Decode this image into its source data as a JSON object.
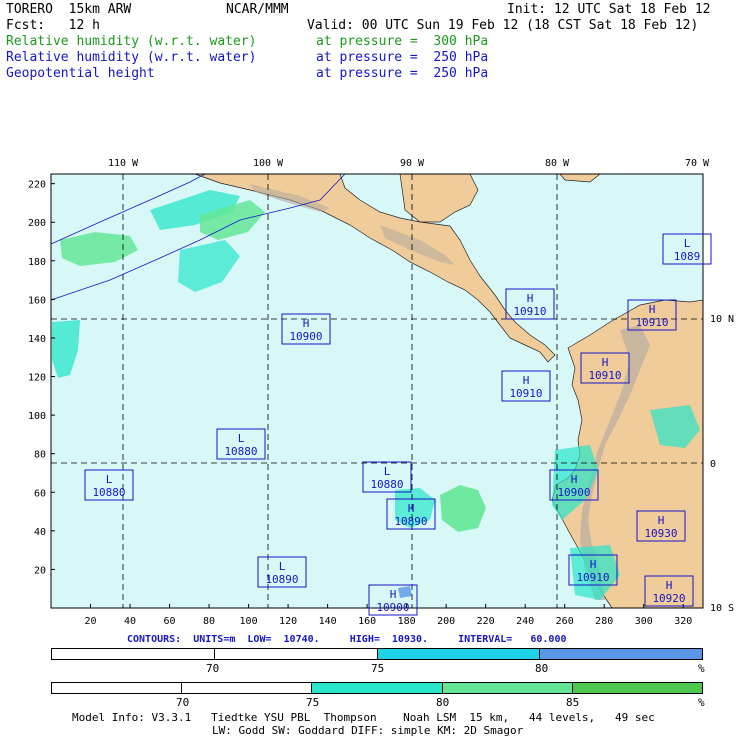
{
  "header": {
    "model": "TORERO  15km ARW",
    "org": "NCAR/MMM",
    "init": "Init: 12 UTC Sat 18 Feb 12",
    "fcst": "Fcst:   12 h",
    "valid": "Valid: 00 UTC Sun 19 Feb 12 (18 CST Sat 18 Feb 12)",
    "fields": [
      {
        "name": "Relative humidity (w.r.t. water)",
        "level": "at pressure =  300 hPa",
        "color": "#1a9a1a"
      },
      {
        "name": "Relative humidity (w.r.t. water)",
        "level": "at pressure =  250 hPa",
        "color": "#1616c8"
      },
      {
        "name": "Geopotential height",
        "level": "at pressure =  250 hPa",
        "color": "#1616c8"
      }
    ]
  },
  "map": {
    "lon_labels": [
      "110 W",
      "100 W",
      "90 W",
      "80 W",
      "70 W"
    ],
    "lat_labels": [
      "10 N",
      "0",
      "10 S"
    ],
    "x_ticks": [
      "20",
      "40",
      "60",
      "80",
      "100",
      "120",
      "140",
      "160",
      "180",
      "200",
      "220",
      "240",
      "260",
      "280",
      "300",
      "320"
    ],
    "y_ticks": [
      "220",
      "200",
      "180",
      "160",
      "140",
      "120",
      "100",
      "80",
      "60",
      "40",
      "20"
    ],
    "centers": [
      {
        "t": "H",
        "v": "10910"
      },
      {
        "t": "H",
        "v": "10900"
      },
      {
        "t": "L",
        "v": "1089"
      },
      {
        "t": "H",
        "v": "10910"
      },
      {
        "t": "H",
        "v": "10910"
      },
      {
        "t": "H",
        "v": "10910"
      },
      {
        "t": "L",
        "v": "10880"
      },
      {
        "t": "L",
        "v": "10880"
      },
      {
        "t": "L",
        "v": "10880"
      },
      {
        "t": "H",
        "v": "10900"
      },
      {
        "t": "H",
        "v": "10890"
      },
      {
        "t": "H",
        "v": "10930"
      },
      {
        "t": "L",
        "v": "10890"
      },
      {
        "t": "H",
        "v": "10910"
      },
      {
        "t": "H",
        "v": "10920"
      },
      {
        "t": "H",
        "v": "10900"
      }
    ]
  },
  "contours": "CONTOURS:  UNITS=m  LOW=  10740.     HIGH=  10930.     INTERVAL=   60.000",
  "legend1": {
    "labels": [
      "70",
      "75",
      "80",
      "%"
    ],
    "colors": [
      "#ffffff",
      "#ffffff",
      "#20d2e6",
      "#5a96e6"
    ]
  },
  "legend2": {
    "labels": [
      "70",
      "75",
      "80",
      "85",
      "%"
    ],
    "colors": [
      "#ffffff",
      "#ffffff",
      "#28e6c8",
      "#64e696",
      "#50c850"
    ]
  },
  "footer": {
    "line1": "Model Info: V3.3.1   Tiedtke YSU PBL  Thompson    Noah LSM  15 km,   44 levels,   49 sec",
    "line2": "LW: Godd SW: Goddard DIFF: simple KM: 2D Smagor"
  }
}
